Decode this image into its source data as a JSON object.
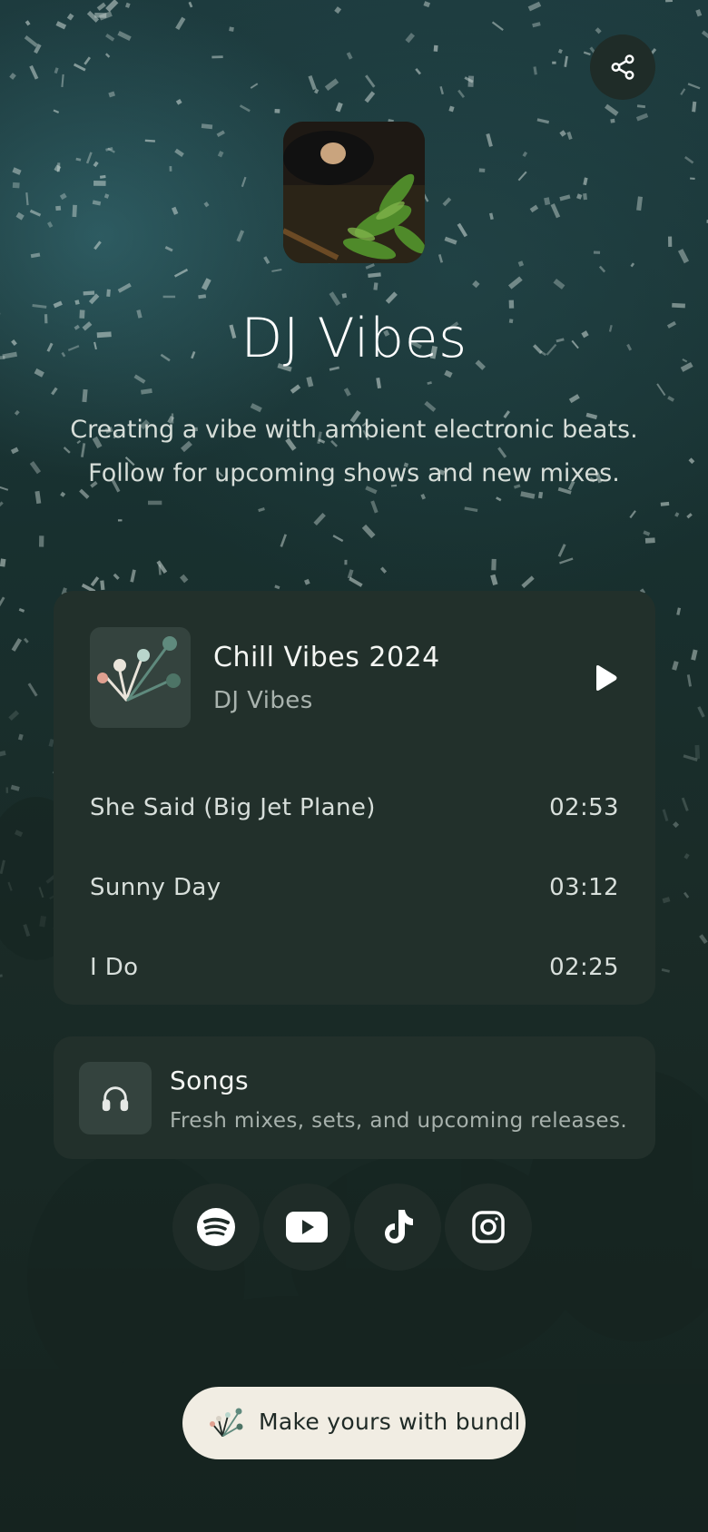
{
  "profile": {
    "name": "DJ Vibes",
    "bio": "Creating a vibe with ambient electronic beats. Follow for upcoming shows and new mixes."
  },
  "share": {
    "icon": "share-icon"
  },
  "music": {
    "album_title": "Chill Vibes 2024",
    "album_artist": "DJ Vibes",
    "play_icon": "play-icon",
    "tracks": [
      {
        "title": "She Said (Big Jet Plane)",
        "duration": "02:53"
      },
      {
        "title": "Sunny Day",
        "duration": "03:12"
      },
      {
        "title": "I Do",
        "duration": "02:25"
      }
    ]
  },
  "link": {
    "title": "Songs",
    "subtitle": "Fresh mixes, sets, and upcoming releases.",
    "icon": "headphones-icon"
  },
  "socials": [
    {
      "icon": "spotify-icon"
    },
    {
      "icon": "youtube-icon"
    },
    {
      "icon": "tiktok-icon"
    },
    {
      "icon": "instagram-icon"
    }
  ],
  "cta": {
    "label": "Make yours with bundl",
    "icon": "bundl-logo-icon"
  },
  "colors": {
    "background": "#1a2b27",
    "card": "#22302b",
    "cta_background": "#f1ede3",
    "text_primary": "#ffffff",
    "text_secondary": "#a9b3ae"
  }
}
